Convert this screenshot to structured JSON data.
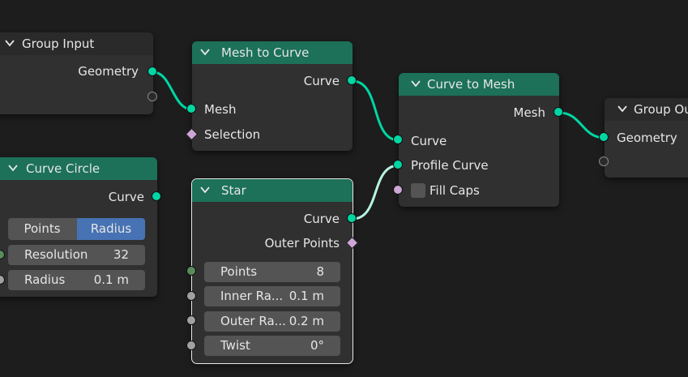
{
  "nodes": {
    "group_input": {
      "title": "Group Input",
      "outputs": {
        "geometry": "Geometry"
      }
    },
    "mesh_to_curve": {
      "title": "Mesh to Curve",
      "outputs": {
        "curve": "Curve"
      },
      "inputs": {
        "mesh": "Mesh",
        "selection": "Selection"
      }
    },
    "curve_to_mesh": {
      "title": "Curve to Mesh",
      "outputs": {
        "mesh": "Mesh"
      },
      "inputs": {
        "curve": "Curve",
        "profile_curve": "Profile Curve",
        "fill_caps": "Fill Caps"
      }
    },
    "group_output": {
      "title": "Group Output",
      "inputs": {
        "geometry": "Geometry"
      }
    },
    "curve_circle": {
      "title": "Curve Circle",
      "outputs": {
        "curve": "Curve"
      },
      "mode_options": [
        "Points",
        "Radius"
      ],
      "active_mode": "Radius",
      "fields": [
        {
          "name": "Resolution",
          "value": "32"
        },
        {
          "name": "Radius",
          "value": "0.1 m"
        }
      ]
    },
    "star": {
      "title": "Star",
      "outputs": {
        "curve": "Curve",
        "outer_points": "Outer Points"
      },
      "fields": [
        {
          "name": "Points",
          "value": "8"
        },
        {
          "name": "Inner Ra...",
          "value": "0.1 m"
        },
        {
          "name": "Outer Ra...",
          "value": "0.2 m"
        },
        {
          "name": "Twist",
          "value": "0°"
        }
      ]
    }
  },
  "colors": {
    "background": "#1d1d1d",
    "node_body": "#303030",
    "geometry_header": "#1c7158",
    "geometry_socket": "#00d6a3",
    "field_socket": "#cca6d6",
    "int_socket": "#598c5c",
    "active_option": "#4772b3"
  }
}
